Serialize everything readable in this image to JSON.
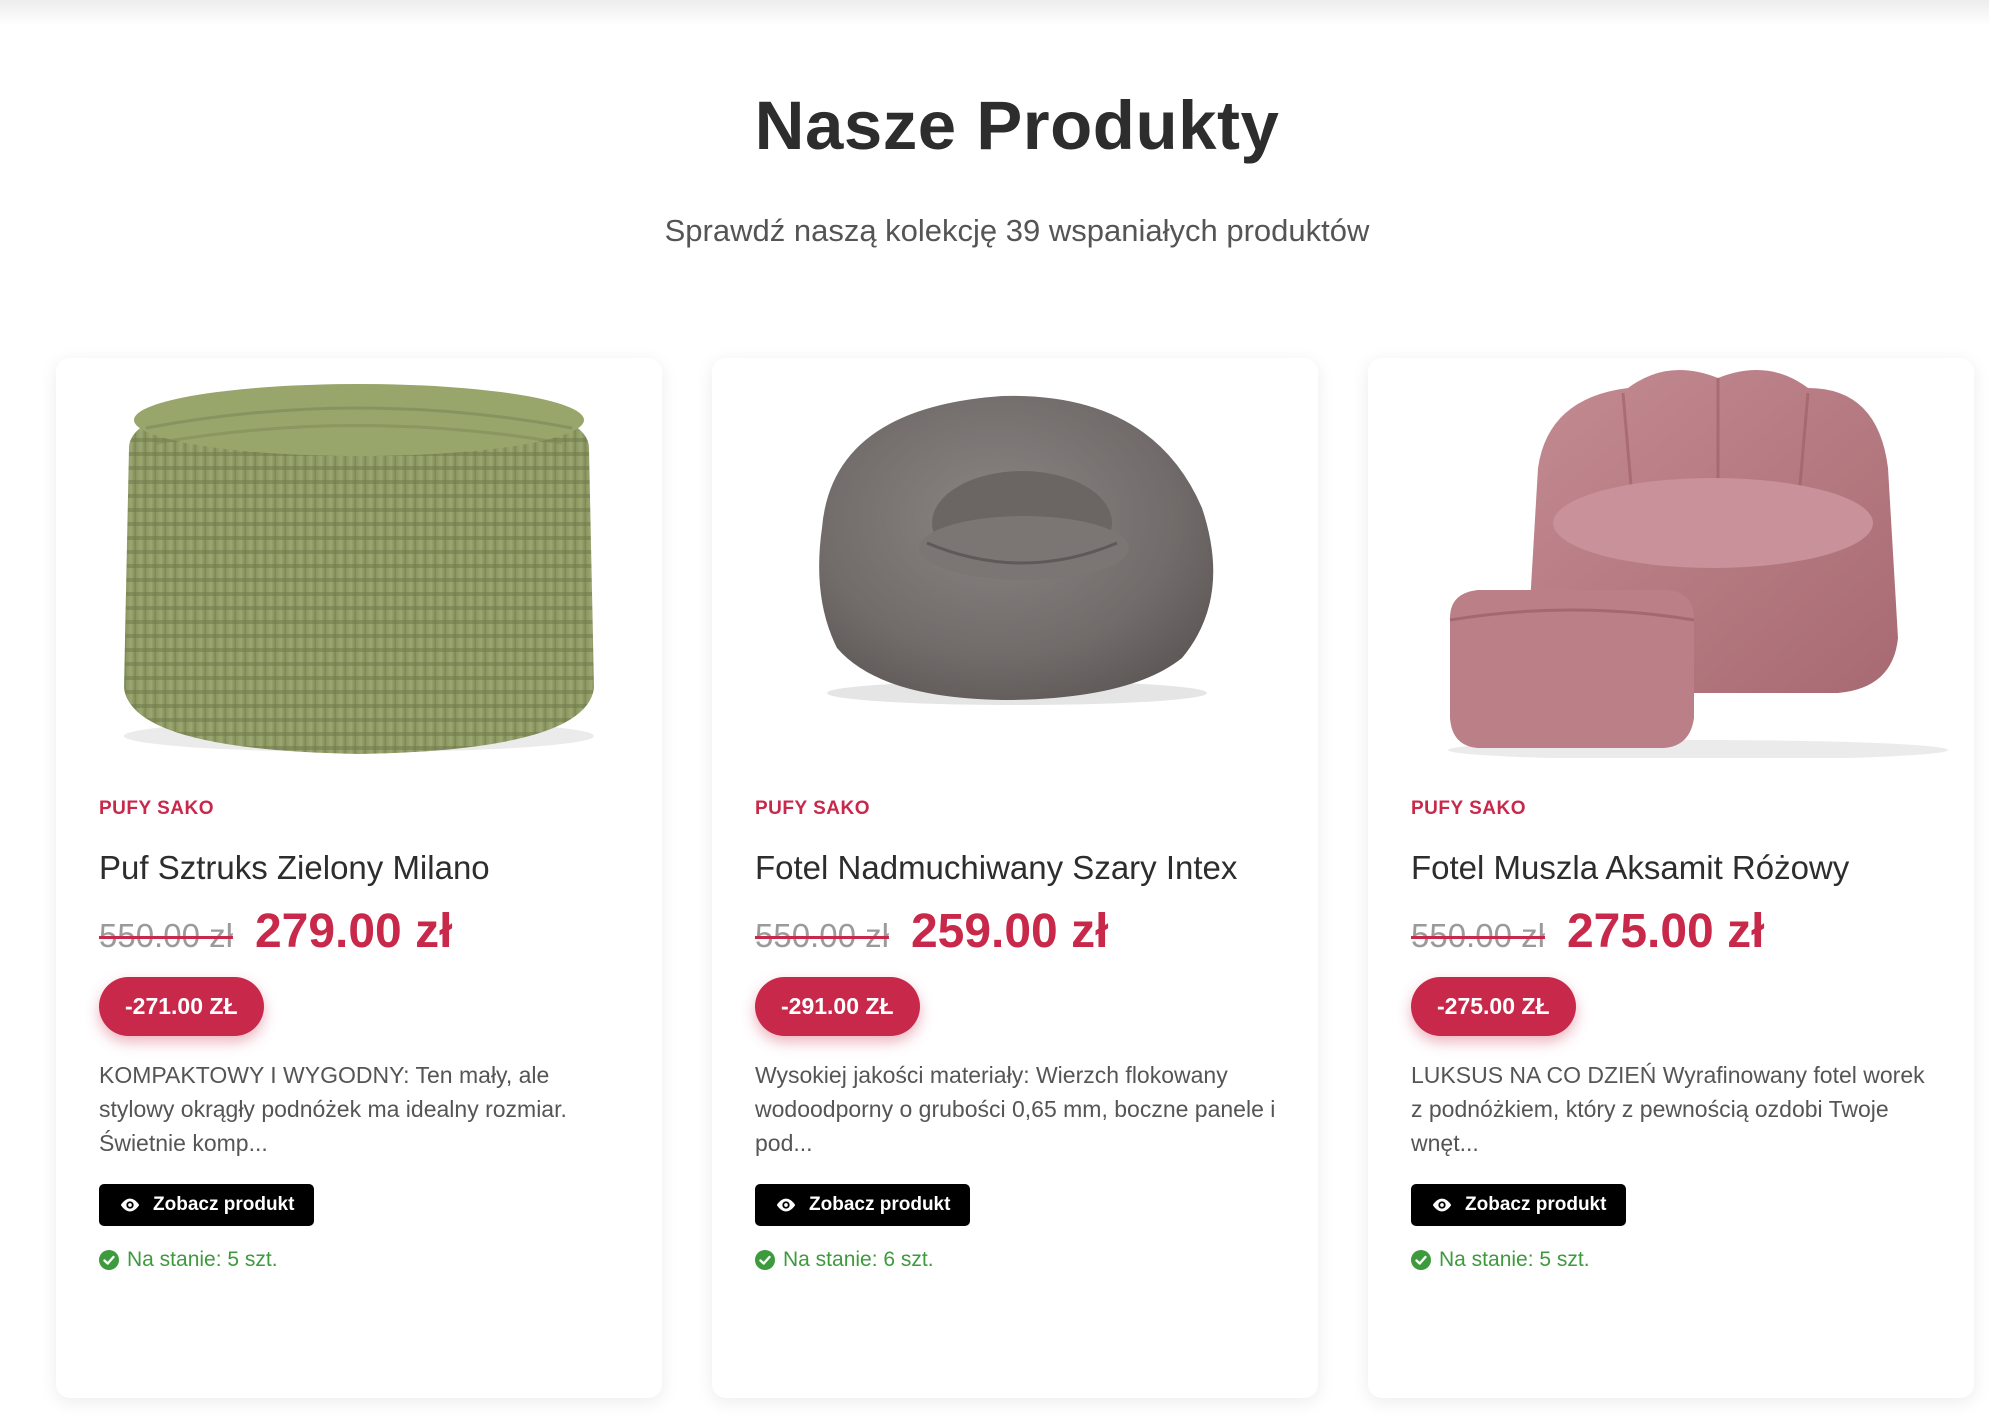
{
  "header": {
    "title": "Nasze Produkty",
    "subtitle": "Sprawdź naszą kolekcję 39 wspaniałych produktów"
  },
  "colors": {
    "accent": "#c8294a",
    "stock_green": "#3d9a3d",
    "button_bg": "#000000"
  },
  "products": [
    {
      "category": "PUFY SAKO",
      "name": "Puf Sztruks Zielony Milano",
      "old_price": "550.00 zł",
      "price": "279.00 zł",
      "discount": "-271.00 ZŁ",
      "description": "KOMPAKTOWY I WYGODNY: Ten mały, ale stylowy okrągły podnóżek ma idealny rozmiar. Świetnie komp...",
      "button_label": "Zobacz produkt",
      "stock": "Na stanie: 5 szt.",
      "image_icon": "green-corduroy-pouf-image"
    },
    {
      "category": "PUFY SAKO",
      "name": "Fotel Nadmuchiwany Szary Intex",
      "old_price": "550.00 zł",
      "price": "259.00 zł",
      "discount": "-291.00 ZŁ",
      "description": "Wysokiej jakości materiały: Wierzch flokowany wodoodporny o grubości 0,65 mm, boczne panele i pod...",
      "button_label": "Zobacz produkt",
      "stock": "Na stanie: 6 szt.",
      "image_icon": "grey-inflatable-chair-image"
    },
    {
      "category": "PUFY SAKO",
      "name": "Fotel Muszla Aksamit Różowy",
      "old_price": "550.00 zł",
      "price": "275.00 zł",
      "discount": "-275.00 ZŁ",
      "description": "LUKSUS NA CO DZIEŃ Wyrafinowany fotel worek z podnóżkiem, który z pewnością ozdobi Twoje wnęt...",
      "button_label": "Zobacz produkt",
      "stock": "Na stanie: 5 szt.",
      "image_icon": "pink-velvet-shell-chair-image"
    }
  ]
}
